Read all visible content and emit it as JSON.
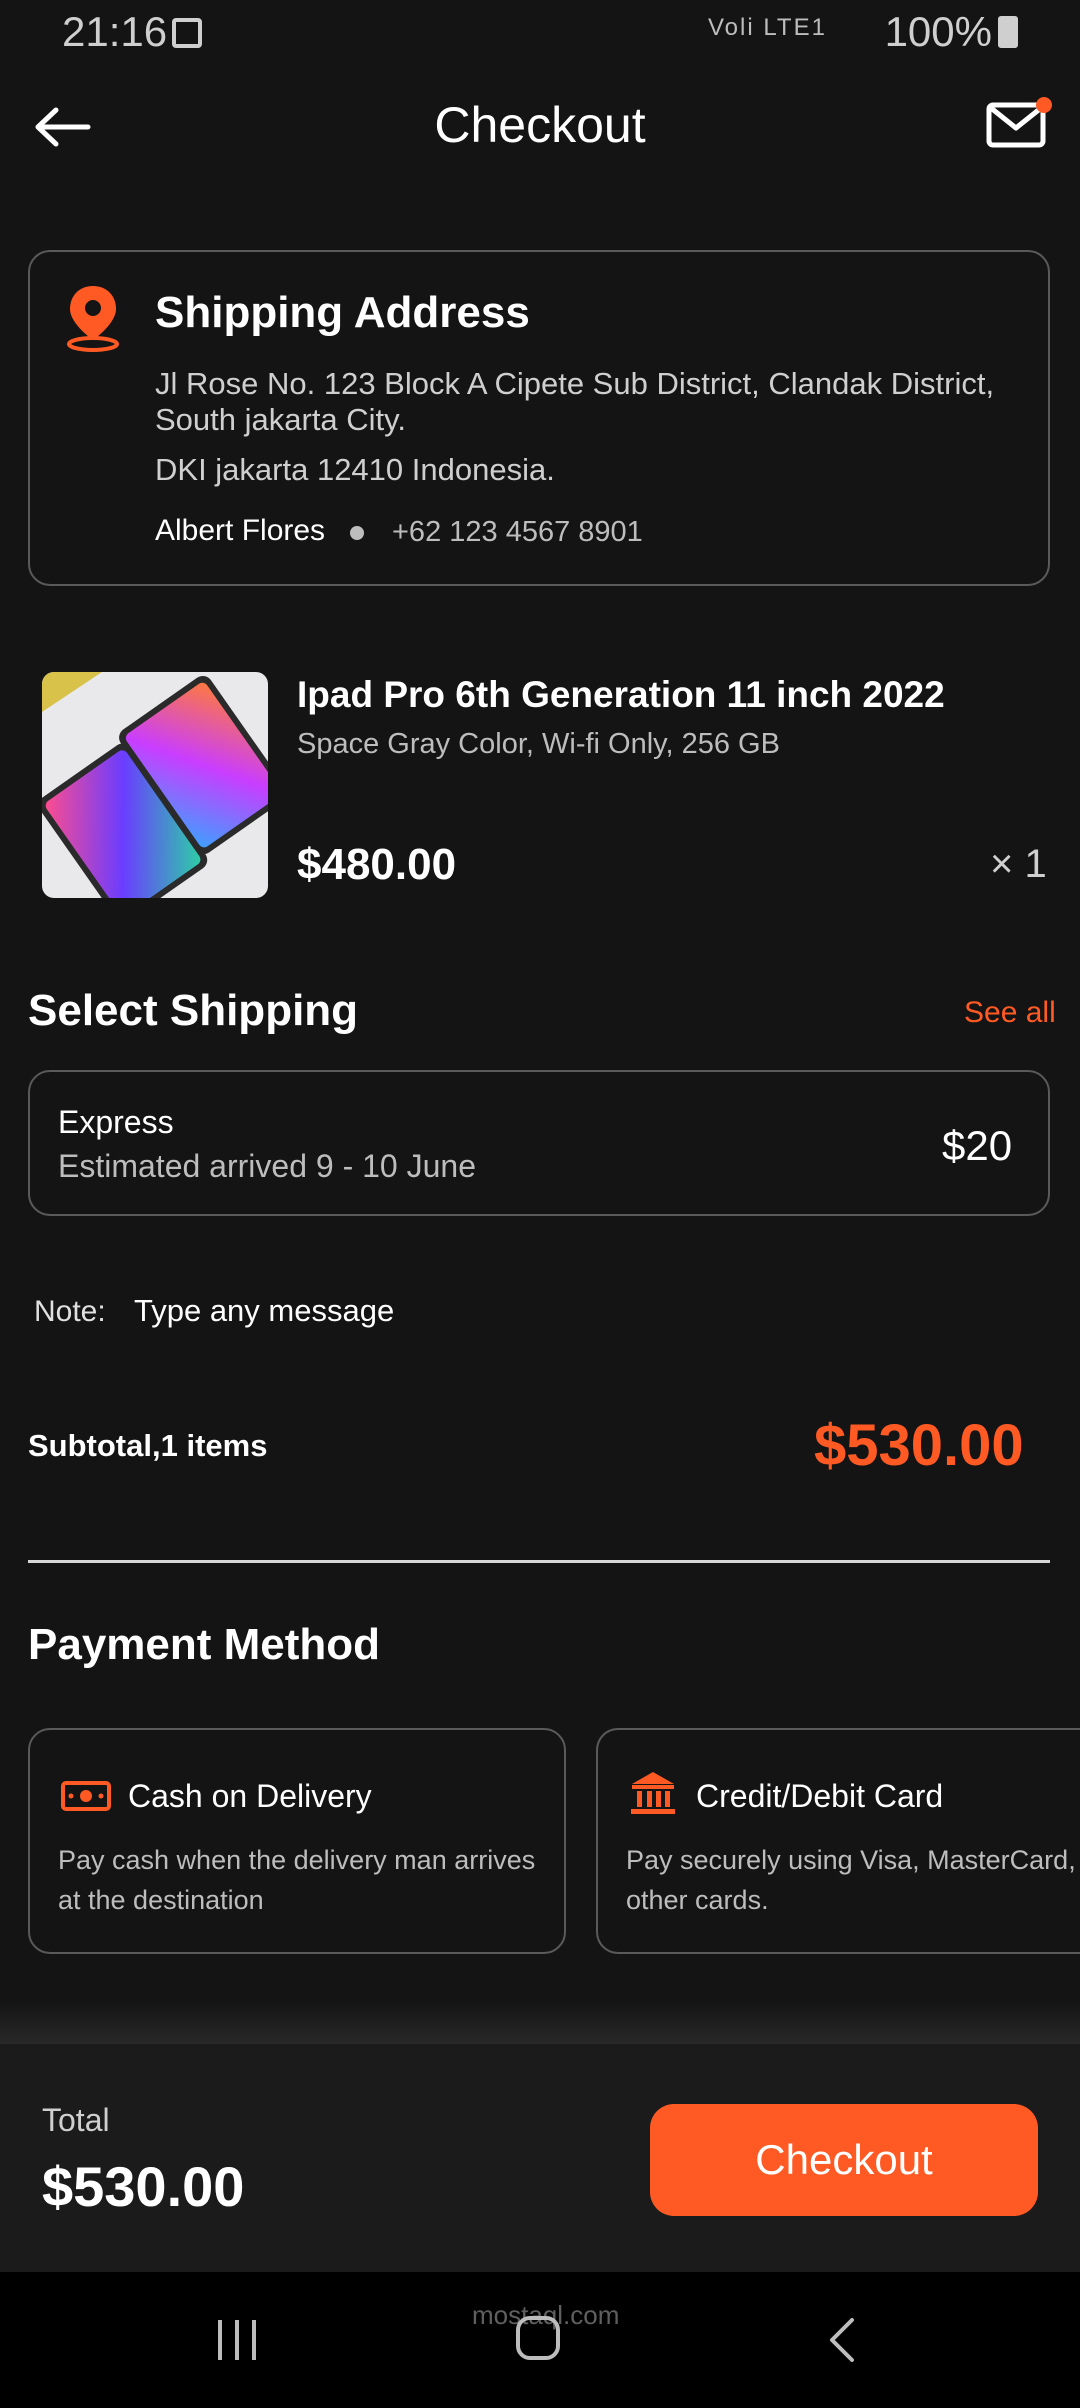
{
  "status": {
    "time": "21:16",
    "battery": "100%",
    "network": "Voli LTE1"
  },
  "header": {
    "title": "Checkout"
  },
  "address": {
    "title": "Shipping Address",
    "line1": "Jl Rose No. 123 Block A Cipete Sub District, Clandak District,",
    "line2": "South jakarta City.",
    "line3": "DKI jakarta 12410 Indonesia.",
    "name": "Albert Flores",
    "phone": "+62 123 4567 8901"
  },
  "product": {
    "name": "Ipad Pro 6th Generation 11 inch 2022",
    "desc": "Space Gray Color, Wi-fi Only, 256 GB",
    "price": "$480.00",
    "qty": "× 1"
  },
  "shipping": {
    "title": "Select Shipping",
    "see_all": "See all",
    "method": "Express",
    "estimate": "Estimated arrived 9 - 10 June",
    "price": "$20"
  },
  "note": {
    "label": "Note:",
    "placeholder": "Type any message"
  },
  "subtotal": {
    "label": "Subtotal,1 items",
    "value": "$530.00"
  },
  "payment": {
    "title": "Payment Method",
    "options": [
      {
        "title": "Cash on Delivery",
        "desc1": "Pay cash when the delivery man arrives",
        "desc2": "at the destination"
      },
      {
        "title": "Credit/Debit Card",
        "desc1": "Pay securely using Visa, MasterCard, or",
        "desc2": "other cards."
      }
    ]
  },
  "footer": {
    "total_label": "Total",
    "total_value": "$530.00",
    "checkout": "Checkout"
  },
  "watermark": "mostaql.com",
  "colors": {
    "accent": "#ff5a24",
    "background": "#141414"
  }
}
